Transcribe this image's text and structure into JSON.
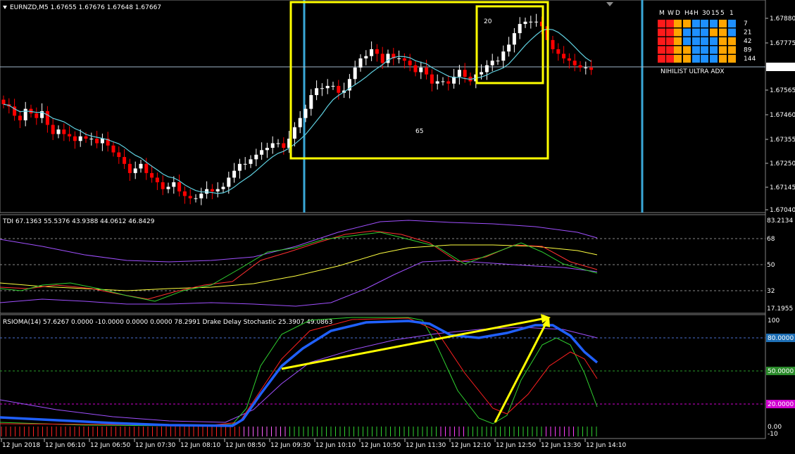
{
  "main": {
    "header": "EURNZD,M5  1.67655 1.67676 1.67648 1.67667",
    "price_ticks": [
      "1.67880",
      "1.67775",
      "1.67565",
      "1.67460",
      "1.67355",
      "1.67250",
      "1.67145",
      "1.67040"
    ],
    "current_price": "1.67667",
    "box_labels": [
      "20",
      "65"
    ],
    "mtf_headers": [
      "M",
      "W",
      "D",
      "H4",
      "H",
      "30",
      "15",
      "5",
      "1"
    ],
    "mtf_periods": [
      "7",
      "21",
      "42",
      "89",
      "144"
    ],
    "mtf_title": "NIHILIST ULTRA ADX",
    "colors": {
      "bull": "#ffffff",
      "bear": "#ff0000",
      "ma": "#5fd0e0",
      "box": "#ffff00",
      "vline": "#3aa8d8"
    }
  },
  "tdi": {
    "header": "TDI 67.1363 55.5376 43.9388 44.0612 46.8429",
    "ticks": [
      "83.2134",
      "68",
      "50",
      "32",
      "17.1955"
    ]
  },
  "rsioma": {
    "header": "RSIOMA(14) 57.6267 0.0000 -10.0000 0.0000 0.0000 78.2991  Drake Delay Stochastic 25.3907 49.0863",
    "ticks": [
      "100",
      "80.0000",
      "50.0000",
      "20.0000",
      "0.00",
      "-10"
    ]
  },
  "time_labels": [
    "12 Jun 2018",
    "12 Jun 06:10",
    "12 Jun 06:50",
    "12 Jun 07:30",
    "12 Jun 08:10",
    "12 Jun 08:50",
    "12 Jun 09:30",
    "12 Jun 10:10",
    "12 Jun 10:50",
    "12 Jun 11:30",
    "12 Jun 12:10",
    "12 Jun 12:50",
    "12 Jun 13:30",
    "12 Jun 14:10"
  ],
  "chart_data": {
    "type": "candlestick",
    "symbol": "EURNZD",
    "timeframe": "M5",
    "ylim": [
      1.6704,
      1.6793
    ],
    "closes": [
      1.675,
      1.6749,
      1.6745,
      1.6743,
      1.6748,
      1.6746,
      1.6744,
      1.6747,
      1.6741,
      1.6737,
      1.6739,
      1.6737,
      1.6736,
      1.6734,
      1.6736,
      1.6735,
      1.6735,
      1.6733,
      1.6735,
      1.6732,
      1.6729,
      1.6727,
      1.6724,
      1.672,
      1.6722,
      1.6724,
      1.672,
      1.6718,
      1.6716,
      1.6713,
      1.6714,
      1.6716,
      1.6712,
      1.671,
      1.6709,
      1.6709,
      1.6711,
      1.6713,
      1.6712,
      1.6713,
      1.6714,
      1.6718,
      1.6721,
      1.6724,
      1.6724,
      1.6726,
      1.6728,
      1.673,
      1.6731,
      1.6733,
      1.6733,
      1.6731,
      1.6735,
      1.674,
      1.6744,
      1.6748,
      1.6754,
      1.6757,
      1.6757,
      1.6758,
      1.6758,
      1.6755,
      1.6756,
      1.6761,
      1.6766,
      1.677,
      1.6771,
      1.6774,
      1.6772,
      1.6768,
      1.6772,
      1.677,
      1.677,
      1.6769,
      1.6767,
      1.6764,
      1.6766,
      1.6763,
      1.6759,
      1.676,
      1.676,
      1.6759,
      1.6762,
      1.6765,
      1.6762,
      1.676,
      1.6763,
      1.6764,
      1.6767,
      1.6769,
      1.6769,
      1.6773,
      1.6776,
      1.6781,
      1.6785,
      1.6786,
      1.6786,
      1.6786,
      1.6784,
      1.6778,
      1.6774,
      1.6772,
      1.677,
      1.6769,
      1.6767,
      1.6766,
      1.6766,
      1.6765
    ],
    "annotations": [
      "20",
      "65"
    ]
  }
}
